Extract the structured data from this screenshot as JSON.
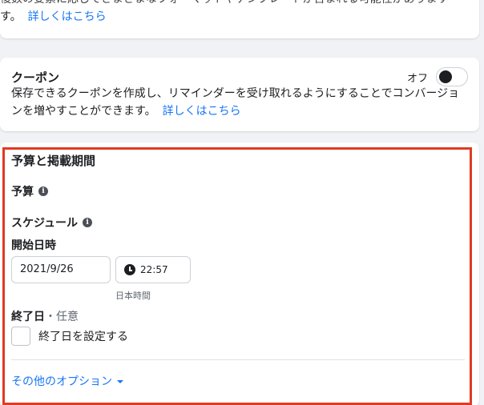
{
  "top_card": {
    "line1": "複数の要素に応じてさまざまなフォーマットやテンプレートが含まれる可能性があります",
    "line2_prefix": "す。",
    "learn_more": "詳しくはこちら"
  },
  "coupon": {
    "title": "クーポン",
    "toggle_label": "オフ",
    "toggle_state": "off",
    "description": "保存できるクーポンを作成し、リマインダーを受け取れるようにすることでコンバージョンを増やすことができます。",
    "learn_more": "詳しくはこちら"
  },
  "budget": {
    "section_title": "予算と掲載期間",
    "budget_label": "予算",
    "schedule_label": "スケジュール",
    "start_label": "開始日時",
    "start_date": "2021/9/26",
    "start_time": "22:57",
    "timezone": "日本時間",
    "end_label": "終了日",
    "end_optional": "・任意",
    "end_checkbox_label": "終了日を設定する",
    "more_options": "その他のオプション"
  },
  "colors": {
    "accent": "#1877f2",
    "highlight_border": "#e03b24",
    "background": "#f0f2f5"
  },
  "icons": {
    "info": "info-icon",
    "clock": "clock-icon",
    "caret": "chevron-down-icon"
  }
}
